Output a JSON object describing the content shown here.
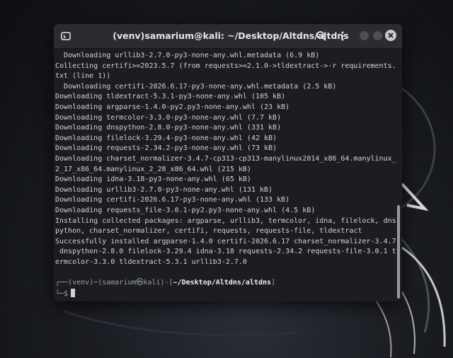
{
  "window": {
    "title": "(venv)samarium@kali: ~/Desktop/Altdns/altdns"
  },
  "icons": {
    "app": "terminal-app-icon",
    "search": "search-icon",
    "menu": "kebab-menu-icon",
    "minimize": "minimize-icon",
    "maximize": "maximize-icon",
    "close": "close-icon"
  },
  "terminal": {
    "lines": [
      "  Downloading urllib3-2.7.0-py3-none-any.whl.metadata (6.9 kB)",
      "Collecting certifi>=2023.5.7 (from requests>=2.1.0->tldextract->-r requirements.",
      "txt (line 1))",
      "  Downloading certifi-2026.6.17-py3-none-any.whl.metadata (2.5 kB)",
      "Downloading tldextract-5.3.1-py3-none-any.whl (105 kB)",
      "Downloading argparse-1.4.0-py2.py3-none-any.whl (23 kB)",
      "Downloading termcolor-3.3.0-py3-none-any.whl (7.7 kB)",
      "Downloading dnspython-2.8.0-py3-none-any.whl (331 kB)",
      "Downloading filelock-3.29.4-py3-none-any.whl (42 kB)",
      "Downloading requests-2.34.2-py3-none-any.whl (73 kB)",
      "Downloading charset_normalizer-3.4.7-cp313-cp313-manylinux2014_x86_64.manylinux_",
      "2_17_x86_64.manylinux_2_28_x86_64.whl (215 kB)",
      "Downloading idna-3.18-py3-none-any.whl (65 kB)",
      "Downloading urllib3-2.7.0-py3-none-any.whl (131 kB)",
      "Downloading certifi-2026.6.17-py3-none-any.whl (133 kB)",
      "Downloading requests_file-3.0.1-py2.py3-none-any.whl (4.5 kB)",
      "Installing collected packages: argparse, urllib3, termcolor, idna, filelock, dns",
      "python, charset_normalizer, certifi, requests, requests-file, tldextract",
      "Successfully installed argparse-1.4.0 certifi-2026.6.17 charset_normalizer-3.4.7",
      " dnspython-2.8.0 filelock-3.29.4 idna-3.18 requests-2.34.2 requests-file-3.0.1 t",
      "ermcolor-3.3.0 tldextract-5.3.1 urllib3-2.7.0"
    ],
    "prompt": {
      "frame_start": "┌──",
      "user": "(venv)─(samarium㉿kali)-[",
      "path": "~/Desktop/Altdns/altdns",
      "frame_end": "]",
      "second_line": "└─$"
    }
  }
}
